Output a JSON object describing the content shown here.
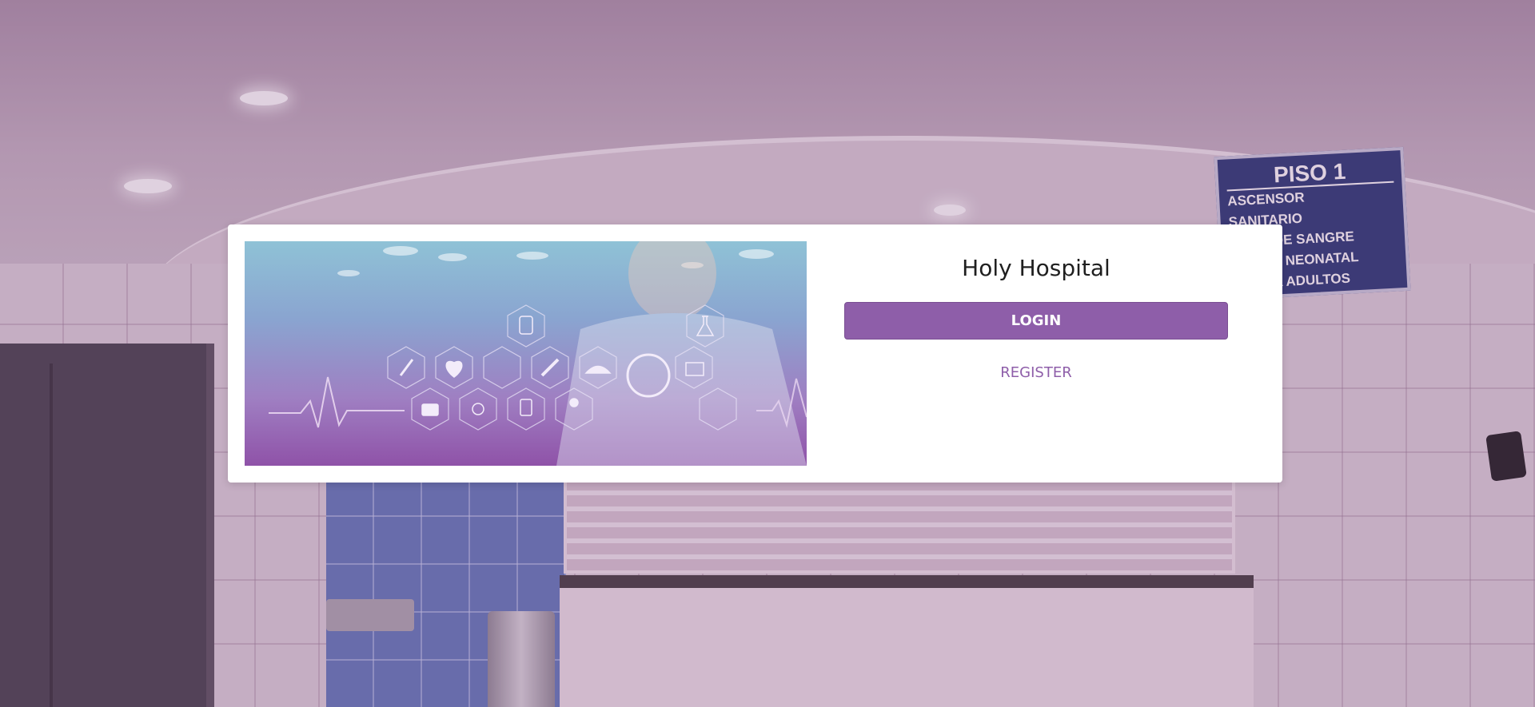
{
  "app": {
    "title": "Holy Hospital"
  },
  "actions": {
    "login_label": "LOGIN",
    "register_label": "REGISTER"
  },
  "background_sign": {
    "title": "PISO 1",
    "lines": [
      "ASCENSOR",
      "SANITARIO",
      "ANCO DE SANGRE",
      "ERAPIA NEONATAL",
      "ERAPIA ADULTOS"
    ]
  },
  "colors": {
    "accent": "#8e5ea9",
    "card_background": "#ffffff",
    "title_text": "#1f1f1f"
  },
  "icons": [
    "iv-bag-icon",
    "flask-icon",
    "pen-icon",
    "heart-rate-icon",
    "syringe-icon",
    "nurse-cap-icon",
    "stethoscope-icon",
    "monitor-icon",
    "first-aid-kit-icon",
    "pills-icon",
    "clipboard-icon",
    "doctor-icon"
  ]
}
